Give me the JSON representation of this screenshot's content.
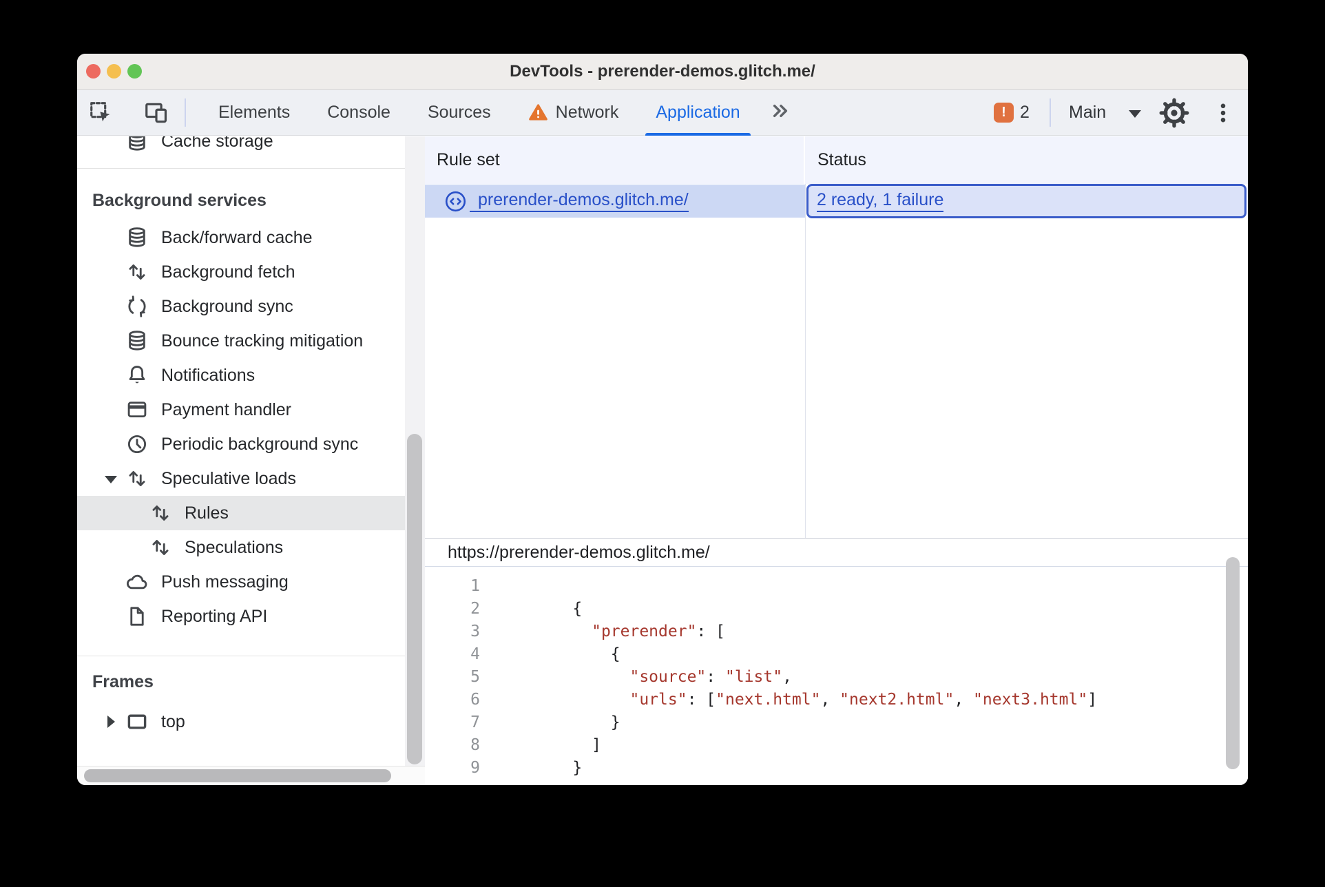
{
  "window_title": "DevTools - prerender-demos.glitch.me/",
  "toolbar": {
    "tabs": [
      {
        "label": "Elements"
      },
      {
        "label": "Console"
      },
      {
        "label": "Sources"
      },
      {
        "label": "Network",
        "warning_icon": "warning-triangle"
      },
      {
        "label": "Application",
        "active": true
      }
    ],
    "more_tabs_icon": "double-chevron",
    "inspect_icon": "inspect-cursor",
    "device_icon": "device-toolbar",
    "issues_badge_icon": "issues-exclamation",
    "issues_count": "2",
    "target_label": "Main",
    "target_caret_icon": "caret-down",
    "settings_icon": "gear",
    "menu_icon": "kebab"
  },
  "sidebar": {
    "rows": [
      {
        "kind": "item",
        "label": "Cache storage",
        "icon": "database",
        "clipped": true
      },
      {
        "kind": "divider"
      },
      {
        "kind": "header",
        "label": "Background services"
      },
      {
        "kind": "item",
        "label": "Back/forward cache",
        "icon": "database"
      },
      {
        "kind": "item",
        "label": "Background fetch",
        "icon": "updown"
      },
      {
        "kind": "item",
        "label": "Background sync",
        "icon": "sync"
      },
      {
        "kind": "item",
        "label": "Bounce tracking mitigation",
        "icon": "database"
      },
      {
        "kind": "item",
        "label": "Notifications",
        "icon": "bell"
      },
      {
        "kind": "item",
        "label": "Payment handler",
        "icon": "card"
      },
      {
        "kind": "item",
        "label": "Periodic background sync",
        "icon": "clock"
      },
      {
        "kind": "item",
        "label": "Speculative loads",
        "icon": "updown",
        "expander": "down"
      },
      {
        "kind": "item",
        "label": "Rules",
        "icon": "updown",
        "indent": true,
        "selected": true
      },
      {
        "kind": "item",
        "label": "Speculations",
        "icon": "updown",
        "indent": true
      },
      {
        "kind": "item",
        "label": "Push messaging",
        "icon": "cloud"
      },
      {
        "kind": "item",
        "label": "Reporting API",
        "icon": "document"
      },
      {
        "kind": "divider"
      },
      {
        "kind": "header",
        "label": "Frames"
      },
      {
        "kind": "item",
        "label": "top",
        "icon": "frame",
        "expander": "right"
      }
    ]
  },
  "rules_table": {
    "columns": [
      "Rule set",
      "Status"
    ],
    "rows": [
      {
        "rule_set": "prerender-demos.glitch.me/",
        "rule_set_icon": "code-circle",
        "status": "2 ready, 1 failure"
      }
    ]
  },
  "preview": {
    "title": "https://prerender-demos.glitch.me/",
    "code": {
      "lines": [
        [],
        [
          {
            "text": "    {",
            "type": "plain"
          }
        ],
        [
          {
            "text": "      ",
            "type": "plain"
          },
          {
            "text": "\"prerender\"",
            "type": "string"
          },
          {
            "text": ": [",
            "type": "plain"
          }
        ],
        [
          {
            "text": "        {",
            "type": "plain"
          }
        ],
        [
          {
            "text": "          ",
            "type": "plain"
          },
          {
            "text": "\"source\"",
            "type": "string"
          },
          {
            "text": ": ",
            "type": "plain"
          },
          {
            "text": "\"list\"",
            "type": "string"
          },
          {
            "text": ",",
            "type": "plain"
          }
        ],
        [
          {
            "text": "          ",
            "type": "plain"
          },
          {
            "text": "\"urls\"",
            "type": "string"
          },
          {
            "text": ": [",
            "type": "plain"
          },
          {
            "text": "\"next.html\"",
            "type": "string"
          },
          {
            "text": ", ",
            "type": "plain"
          },
          {
            "text": "\"next2.html\"",
            "type": "string"
          },
          {
            "text": ", ",
            "type": "plain"
          },
          {
            "text": "\"next3.html\"",
            "type": "string"
          },
          {
            "text": "]",
            "type": "plain"
          }
        ],
        [
          {
            "text": "        }",
            "type": "plain"
          }
        ],
        [
          {
            "text": "      ]",
            "type": "plain"
          }
        ],
        [
          {
            "text": "    }",
            "type": "plain"
          }
        ]
      ]
    }
  },
  "colors": {
    "accent_blue": "#1b6ae4",
    "link_blue": "#2950c8",
    "focus_ring": "#3a5cc9",
    "selected_row_bg": "#ccd8f4",
    "status_cell_bg": "#dbe2f9",
    "table_header_bg": "#f2f4fd",
    "warning_orange": "#e4752e",
    "issues_badge_orange": "#e0713f",
    "code_string_red": "#a5372d",
    "sidebar_selected_bg": "#e6e7e8"
  }
}
